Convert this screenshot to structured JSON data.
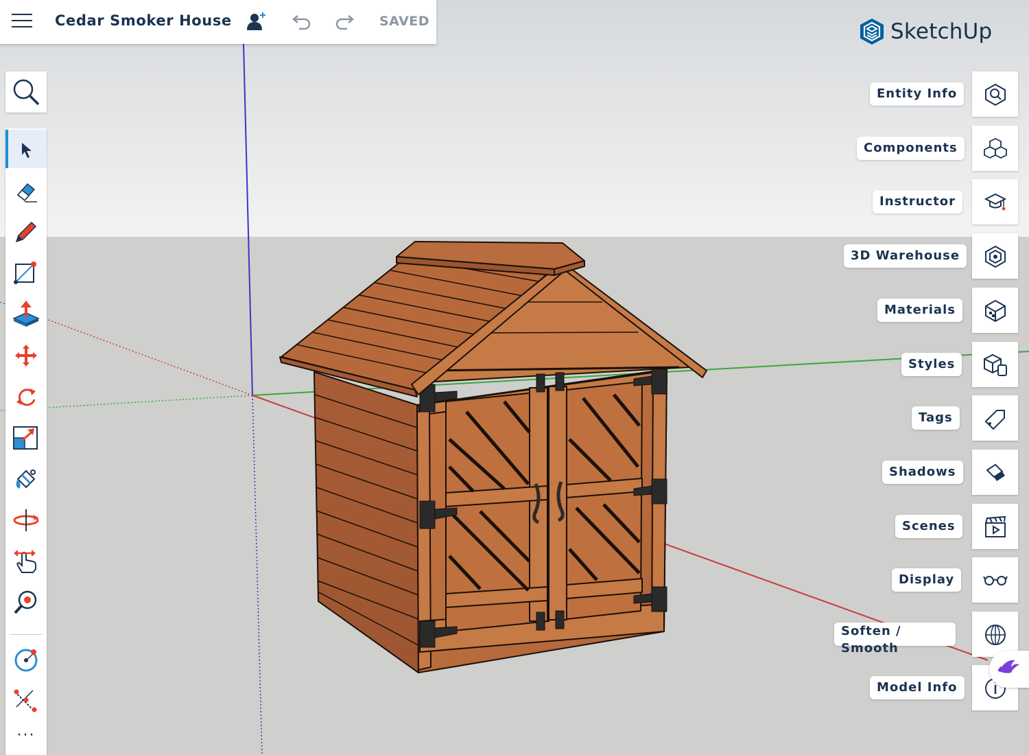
{
  "document": {
    "title": "Cedar Smoker House",
    "save_status": "SAVED"
  },
  "brand": {
    "name": "SketchUp",
    "accent": "#005F9E"
  },
  "toolbar": {
    "search_icon": "search-icon",
    "tools": [
      {
        "name": "select",
        "icon": "arrow-cursor-icon",
        "active": true
      },
      {
        "name": "eraser",
        "icon": "eraser-icon"
      },
      {
        "name": "pencil",
        "icon": "pencil-icon"
      },
      {
        "name": "rectangle",
        "icon": "rectangle-icon"
      },
      {
        "name": "push-pull",
        "icon": "push-pull-icon"
      },
      {
        "name": "move",
        "icon": "move-icon"
      },
      {
        "name": "rotate",
        "icon": "rotate-icon"
      },
      {
        "name": "scale",
        "icon": "scale-icon"
      },
      {
        "name": "paint-bucket",
        "icon": "paint-bucket-icon"
      },
      {
        "name": "orbit",
        "icon": "orbit-icon"
      },
      {
        "name": "pan",
        "icon": "pan-hand-icon"
      },
      {
        "name": "zoom-extents",
        "icon": "zoom-extents-icon"
      },
      {
        "name": "circle",
        "icon": "circle-icon"
      },
      {
        "name": "tape-measure",
        "icon": "tape-measure-icon"
      }
    ],
    "more": "···"
  },
  "panels": [
    {
      "label": "Entity Info",
      "icon": "entity-info-icon"
    },
    {
      "label": "Components",
      "icon": "components-icon"
    },
    {
      "label": "Instructor",
      "icon": "instructor-icon"
    },
    {
      "label": "3D Warehouse",
      "icon": "warehouse-icon"
    },
    {
      "label": "Materials",
      "icon": "materials-icon"
    },
    {
      "label": "Styles",
      "icon": "styles-icon"
    },
    {
      "label": "Tags",
      "icon": "tag-icon"
    },
    {
      "label": "Shadows",
      "icon": "shadows-icon"
    },
    {
      "label": "Scenes",
      "icon": "scenes-icon"
    },
    {
      "label": "Display",
      "icon": "glasses-icon"
    },
    {
      "label": "Soften / Smooth",
      "icon": "soften-icon"
    },
    {
      "label": "Model Info",
      "icon": "info-icon"
    }
  ],
  "colors": {
    "sky_top": "#d9dcdf",
    "sky_bottom": "#f2f2f2",
    "ground": "#cfcfcd",
    "wood": "#b5683a",
    "axis_red": "#d23a3a",
    "axis_green": "#3aa83a",
    "axis_blue": "#3b3bc8"
  }
}
